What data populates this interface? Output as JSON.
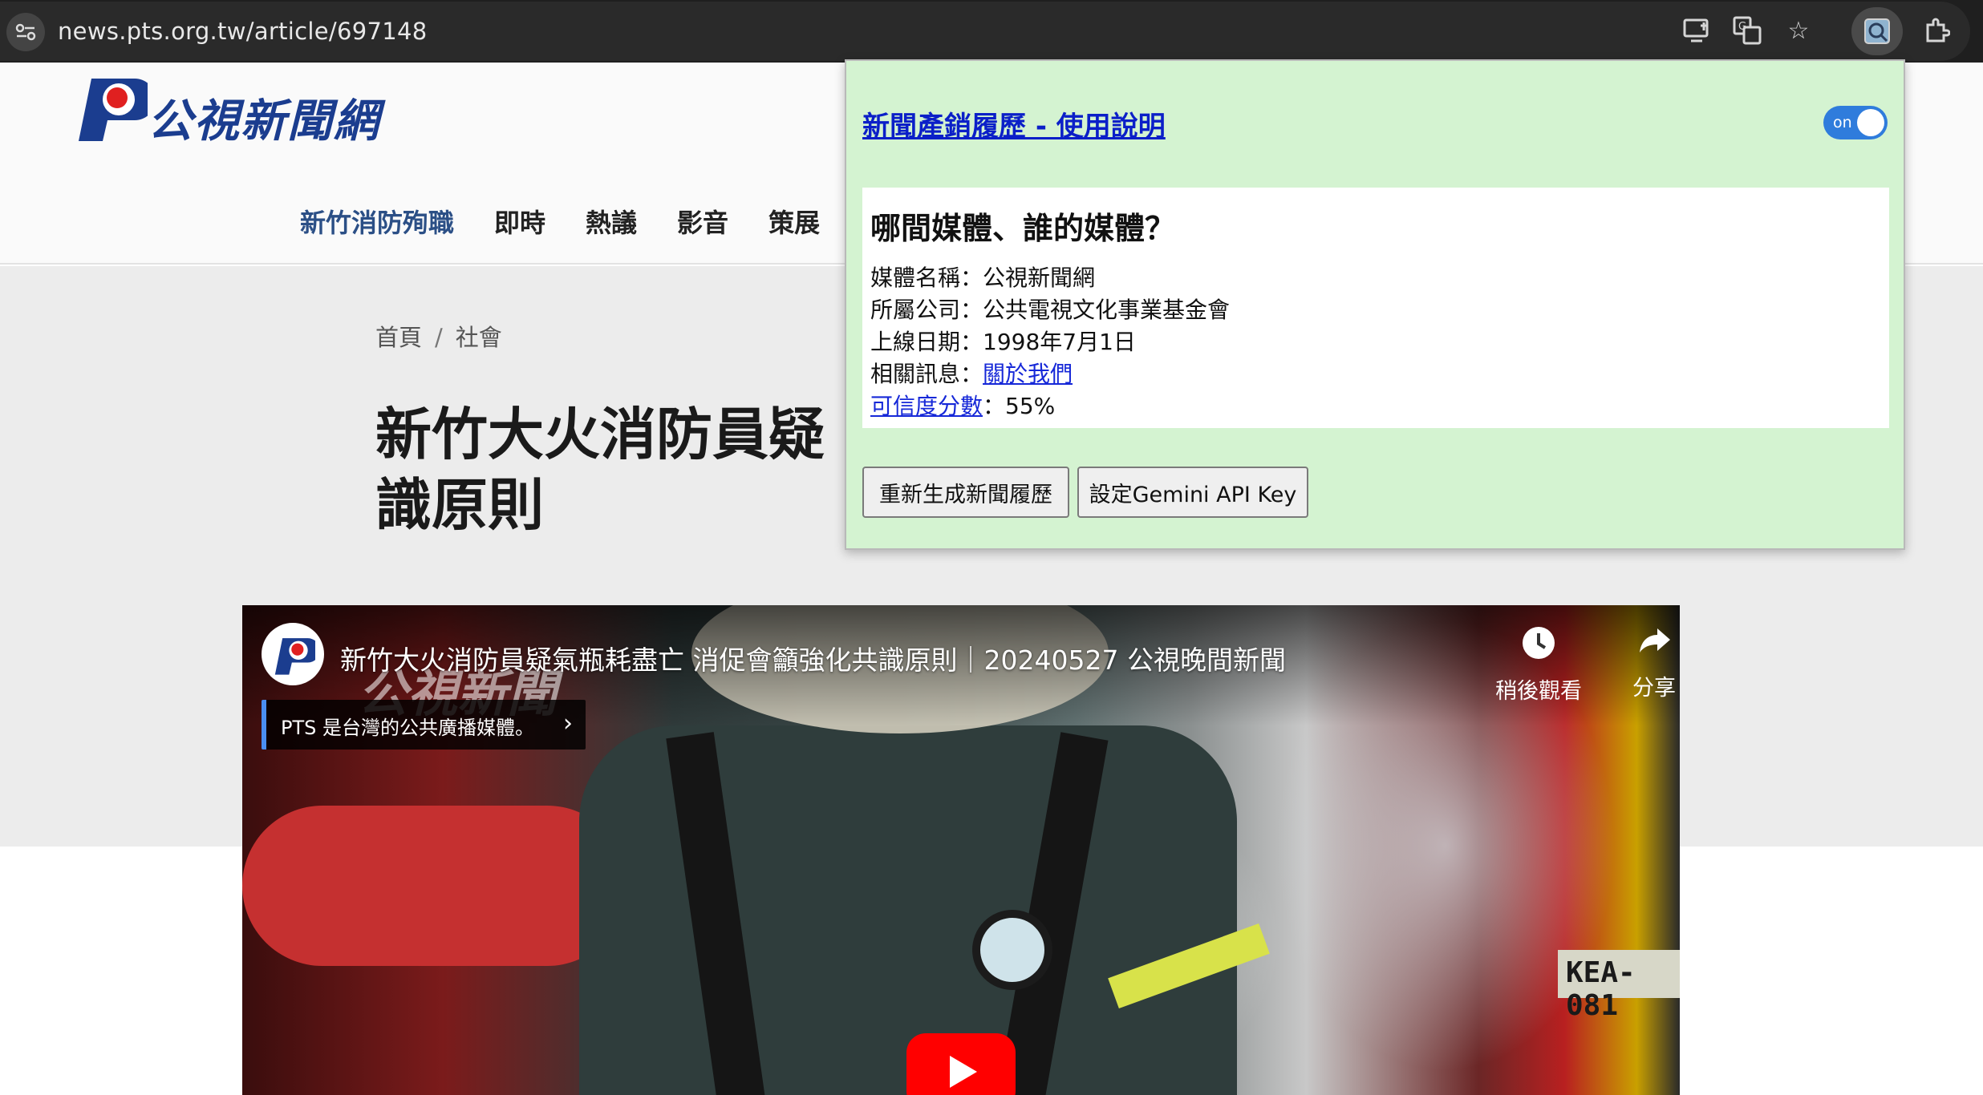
{
  "browser": {
    "url": "news.pts.org.tw/article/697148",
    "icons": [
      "site-info-icon",
      "install-app-icon",
      "translate-icon",
      "bookmark-star-icon",
      "extension-active-icon",
      "extensions-puzzle-icon"
    ]
  },
  "site": {
    "logo_text": "公視新聞網",
    "nav": [
      "新竹消防殉職",
      "即時",
      "熱議",
      "影音",
      "策展"
    ],
    "breadcrumb": {
      "home": "首頁",
      "separator": "/",
      "section": "社會"
    },
    "title_line1": "新竹大火消防員疑",
    "title_line2": "識原則"
  },
  "video": {
    "title": "新竹大火消防員疑氣瓶耗盡亡 消促會籲強化共識原則｜20240527 公視晚間新聞",
    "watermark": "公視新聞",
    "info_card": "PTS 是台灣的公共廣播媒體。",
    "watch_later": "稍後觀看",
    "share": "分享",
    "plate": "KEA-081"
  },
  "popup": {
    "help_link": "新聞產銷履歷 - 使用說明",
    "toggle_label": "on",
    "heading": "哪間媒體、誰的媒體？",
    "media_name_label": "媒體名稱：",
    "media_name": "公視新聞網",
    "company_label": "所屬公司：",
    "company": "公共電視文化事業基金會",
    "launch_label": "上線日期：",
    "launch_date": "1998年7月1日",
    "related_label": "相關訊息：",
    "related_link": "關於我們",
    "credibility_link": "可信度分數",
    "credibility_sep": "：",
    "credibility_value": "55%",
    "regenerate_button": "重新生成新聞履歷",
    "api_key_button": "設定Gemini API Key"
  },
  "colors": {
    "popup_bg": "#d4f3d1",
    "link": "#0b1fc8",
    "toggle": "#2f7cdc",
    "nav_active": "#2b4f86",
    "logo_blue": "#1b3d8f",
    "logo_red": "#e02020"
  }
}
